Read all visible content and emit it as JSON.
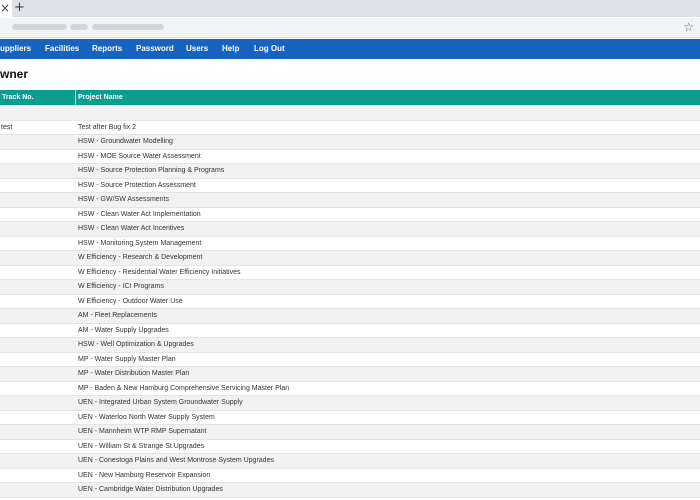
{
  "browser": {
    "close_tab_glyph": "×",
    "new_tab_glyph": "+",
    "bookmark_glyph": "☆"
  },
  "nav": {
    "items": [
      "uppliers",
      "Facilities",
      "Reports",
      "Password",
      "Users",
      "Help",
      "Log Out"
    ]
  },
  "page": {
    "title": "wner"
  },
  "table": {
    "columns": [
      "Track No.",
      "Project Name"
    ],
    "rows": [
      {
        "track": "",
        "name": ""
      },
      {
        "track": "test",
        "name": "Test after Bug fix 2"
      },
      {
        "track": "",
        "name": "HSW - Groundwater Modelling"
      },
      {
        "track": "",
        "name": "HSW - MOE Source Water Assessment"
      },
      {
        "track": "",
        "name": "HSW - Source Protection Planning & Programs"
      },
      {
        "track": "",
        "name": "HSW - Source Protection Assessment"
      },
      {
        "track": "",
        "name": "HSW - GW/SW Assessments"
      },
      {
        "track": "",
        "name": "HSW - Clean Water Act Implementation"
      },
      {
        "track": "",
        "name": "HSW - Clean Water Act Incentives"
      },
      {
        "track": "",
        "name": "HSW - Monitoring System Management"
      },
      {
        "track": "",
        "name": "W Efficiency - Research & Development"
      },
      {
        "track": "",
        "name": "W Efficiency - Residential Water Efficiency Initiatives"
      },
      {
        "track": "",
        "name": "W Efficiency - ICI Programs"
      },
      {
        "track": "",
        "name": "W Efficiency - Outdoor Water Use"
      },
      {
        "track": "",
        "name": "AM - Fleet Replacements"
      },
      {
        "track": "",
        "name": "AM - Water Supply Upgrades"
      },
      {
        "track": "",
        "name": "HSW - Well Optimization & Upgrades"
      },
      {
        "track": "",
        "name": "MP - Water Supply Master Plan"
      },
      {
        "track": "",
        "name": "MP - Water Distribution Master Plan"
      },
      {
        "track": "",
        "name": "MP - Baden & New Hamburg Comprehensive Servicing Master Plan"
      },
      {
        "track": "",
        "name": "UEN - Integrated Urban System Groundwater Supply"
      },
      {
        "track": "",
        "name": "UEN - Waterloo North Water Supply System"
      },
      {
        "track": "",
        "name": "UEN - Mannheim WTP RMP Supernatant"
      },
      {
        "track": "",
        "name": "UEN - William St & Strange St Upgrades"
      },
      {
        "track": "",
        "name": "UEN - Conestoga Plains and West Montrose System Upgrades"
      },
      {
        "track": "",
        "name": "UEN - New Hamburg Reservoir Expansion"
      },
      {
        "track": "",
        "name": "UEN - Cambridge Water Distribution Upgrades"
      },
      {
        "track": "",
        "name": ""
      }
    ]
  },
  "colors": {
    "nav_bg": "#1664c0",
    "table_header_bg": "#0b9d8f",
    "row_alt_bg": "#f2f2f2"
  }
}
